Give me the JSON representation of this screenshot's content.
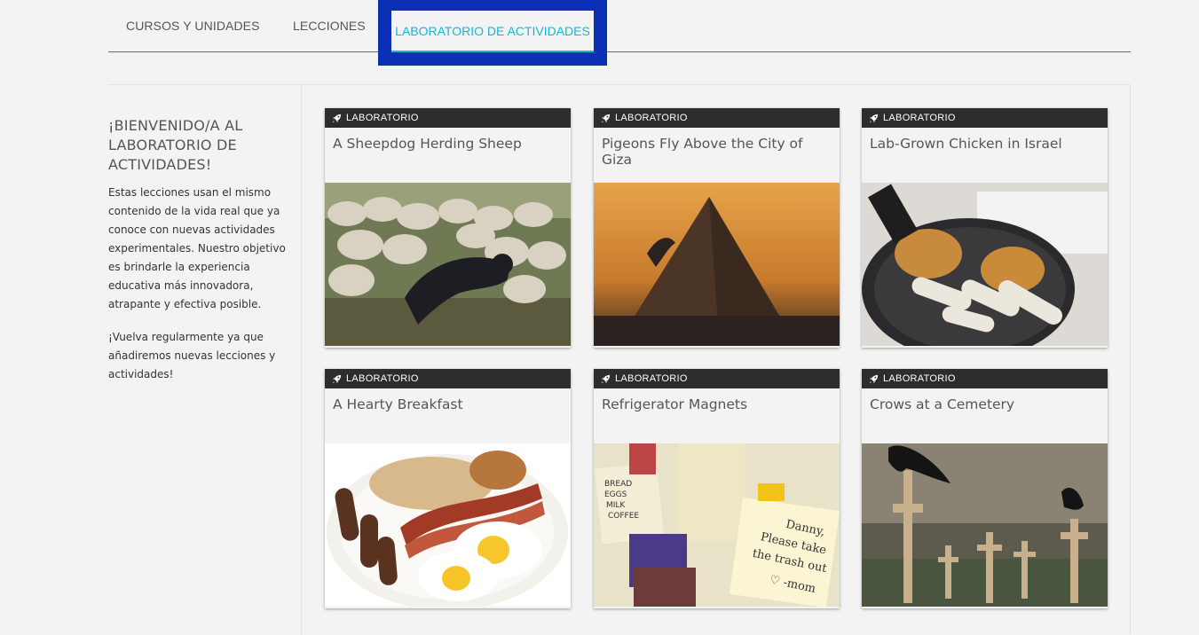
{
  "tabs": {
    "courses": "CURSOS Y UNIDADES",
    "lessons": "LECCIONES",
    "lab": "LABORATORIO DE ACTIVIDADES"
  },
  "sidebar": {
    "heading": "¡BIENVENIDO/A AL LABORATORIO DE ACTIVIDADES!",
    "paragraph1": "Estas lecciones usan el mismo contenido de la vida real que ya conoce con nuevas actividades experimentales. Nuestro objetivo es brindarle la experiencia educativa más innovadora, atrapante y efectiva posible.",
    "paragraph2": "¡Vuelva regularmente ya que añadiremos nuevas lecciones y actividades!"
  },
  "cards": [
    {
      "badge": "LABORATORIO",
      "title": "A Sheepdog Herding Sheep",
      "image": "sheepdog-photo"
    },
    {
      "badge": "LABORATORIO",
      "title": "Pigeons Fly Above the City of Giza",
      "image": "pyramid-photo"
    },
    {
      "badge": "LABORATORIO",
      "title": "Lab-Grown Chicken in Israel",
      "image": "chicken-photo"
    },
    {
      "badge": "LABORATORIO",
      "title": "A Hearty Breakfast",
      "image": "breakfast-photo"
    },
    {
      "badge": "LABORATORIO",
      "title": "Refrigerator Magnets",
      "image": "magnets-photo"
    },
    {
      "badge": "LABORATORIO",
      "title": "Crows at a Cemetery",
      "image": "crows-photo"
    }
  ],
  "magnets_note": {
    "list": [
      "BREAD",
      "EGGS",
      "MILK",
      "COFFEE"
    ],
    "note": [
      "Danny,",
      "Please take",
      "the trash out",
      "♡ -mom"
    ]
  }
}
